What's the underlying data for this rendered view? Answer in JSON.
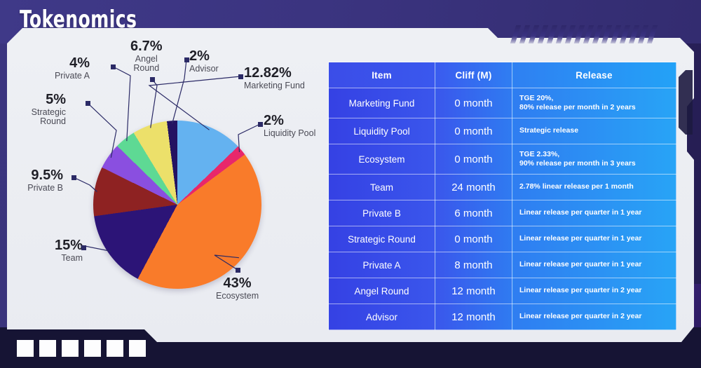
{
  "header": {
    "title": "Tokenomics"
  },
  "chart_data": {
    "type": "pie",
    "title": "Tokenomics",
    "legend_position": "callout-labels",
    "categories": [
      "Marketing Fund",
      "Liquidity Pool",
      "Ecosystem",
      "Team",
      "Private B",
      "Strategic Round",
      "Private A",
      "Angel Round",
      "Advisor"
    ],
    "values": [
      12.82,
      2,
      43,
      15,
      9.5,
      5,
      4,
      6.7,
      2
    ],
    "value_labels": [
      "12.82%",
      "2%",
      "43%",
      "15%",
      "9.5%",
      "5%",
      "4%",
      "6.7%",
      "2%"
    ],
    "colors": [
      "#64b2f0",
      "#e8276b",
      "#f97b2a",
      "#2c1477",
      "#8e2222",
      "#8a4fe0",
      "#5ed994",
      "#ece06a",
      "#241362"
    ],
    "unit": "%"
  },
  "labels": [
    {
      "pct": "12.82%",
      "name": "Marketing Fund"
    },
    {
      "pct": "2%",
      "name": "Liquidity Pool"
    },
    {
      "pct": "43%",
      "name": "Ecosystem"
    },
    {
      "pct": "15%",
      "name": "Team"
    },
    {
      "pct": "9.5%",
      "name": "Private B"
    },
    {
      "pct": "5%",
      "name": "Strategic\nRound"
    },
    {
      "pct": "4%",
      "name": "Private A"
    },
    {
      "pct": "6.7%",
      "name": "Angel\nRound"
    },
    {
      "pct": "2%",
      "name": "Advisor"
    }
  ],
  "table": {
    "headers": [
      "Item",
      "Cliff (M)",
      "Release"
    ],
    "rows": [
      {
        "item": "Marketing Fund",
        "cliff": "0 month",
        "release": "TGE 20%,\n80% release per month in 2 years"
      },
      {
        "item": "Liquidity Pool",
        "cliff": "0 month",
        "release": "Strategic release"
      },
      {
        "item": "Ecosystem",
        "cliff": "0 month",
        "release": "TGE 2.33%,\n90% release per month in 3 years"
      },
      {
        "item": "Team",
        "cliff": "24 month",
        "release": "2.78% linear release per 1 month"
      },
      {
        "item": "Private B",
        "cliff": "6 month",
        "release": "Linear release per quarter in 1 year"
      },
      {
        "item": "Strategic Round",
        "cliff": "0 month",
        "release": "Linear release per quarter in 1 year"
      },
      {
        "item": "Private A",
        "cliff": "8 month",
        "release": "Linear release per quarter in 1 year"
      },
      {
        "item": "Angel Round",
        "cliff": "12 month",
        "release": "Linear release per quarter in 2 year"
      },
      {
        "item": "Advisor",
        "cliff": "12 month",
        "release": "Linear release per quarter in 2 year"
      }
    ]
  },
  "decor": {
    "stripe_count": 16,
    "square_count": 6,
    "accent_navy": "#2b2a66",
    "panel_bg": "#eef0f4"
  }
}
